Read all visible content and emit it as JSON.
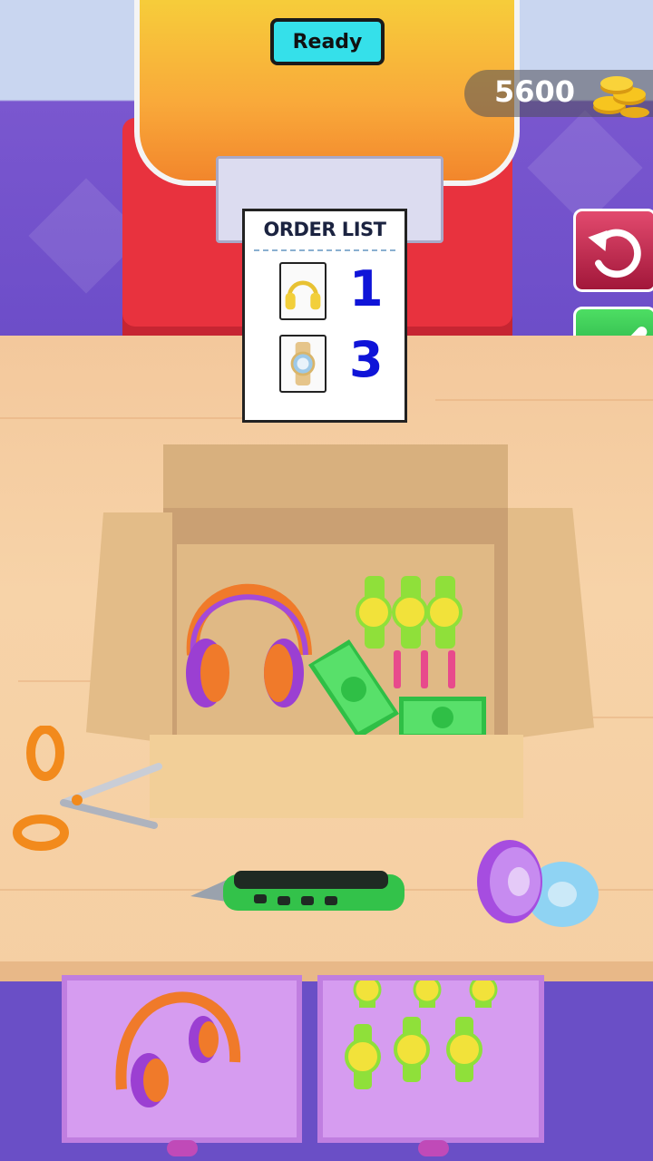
{
  "status": {
    "ready_label": "Ready"
  },
  "currency": {
    "coins": "5600",
    "icon": "coin-stack-icon"
  },
  "order_list": {
    "title": "ORDER LIST",
    "items": [
      {
        "icon": "headphones-icon",
        "quantity": "1"
      },
      {
        "icon": "wristwatch-icon",
        "quantity": "3"
      }
    ]
  },
  "actions": {
    "undo_icon": "undo-arrow-icon",
    "confirm_icon": "checkmark-icon"
  },
  "colors": {
    "ready": "#35e0ea",
    "undo": "#c2244c",
    "confirm": "#22b044",
    "quantity": "#0f14d8"
  }
}
